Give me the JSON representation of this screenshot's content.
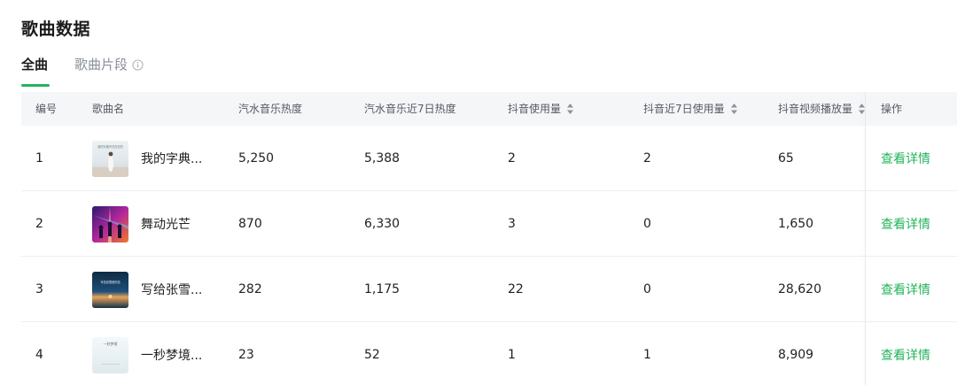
{
  "page": {
    "title": "歌曲数据"
  },
  "tabs": [
    {
      "label": "全曲",
      "active": true
    },
    {
      "label": "歌曲片段",
      "active": false
    }
  ],
  "table": {
    "columns": [
      {
        "label": "编号",
        "sortable": false
      },
      {
        "label": "歌曲名",
        "sortable": false
      },
      {
        "label": "汽水音乐热度",
        "sortable": false
      },
      {
        "label": "汽水音乐近7日热度",
        "sortable": false
      },
      {
        "label": "抖音使用量",
        "sortable": true
      },
      {
        "label": "抖音近7日使用量",
        "sortable": true
      },
      {
        "label": "抖音视频播放量",
        "sortable": true
      },
      {
        "label": "操作",
        "sortable": false
      }
    ],
    "rows": [
      {
        "index": "1",
        "name": "我的字典...",
        "thumb_text": "我的字典不在在在的",
        "qs_heat": "5,250",
        "qs_heat7": "5,388",
        "dy_use": "2",
        "dy_use7": "2",
        "dy_play": "65",
        "action": "查看详情"
      },
      {
        "index": "2",
        "name": "舞动光芒",
        "thumb_text": "",
        "qs_heat": "870",
        "qs_heat7": "6,330",
        "dy_use": "3",
        "dy_use7": "0",
        "dy_play": "1,650",
        "action": "查看详情"
      },
      {
        "index": "3",
        "name": "写给张雪...",
        "thumb_text": "写给张雪峰的信",
        "qs_heat": "282",
        "qs_heat7": "1,175",
        "dy_use": "22",
        "dy_use7": "0",
        "dy_play": "28,620",
        "action": "查看详情"
      },
      {
        "index": "4",
        "name": "一秒梦境...",
        "thumb_text": "一秒梦境",
        "qs_heat": "23",
        "qs_heat7": "52",
        "dy_use": "1",
        "dy_use7": "1",
        "dy_play": "8,909",
        "action": "查看详情"
      }
    ]
  },
  "colors": {
    "accent": "#22b45a",
    "header_bg": "#f5f6f8"
  }
}
